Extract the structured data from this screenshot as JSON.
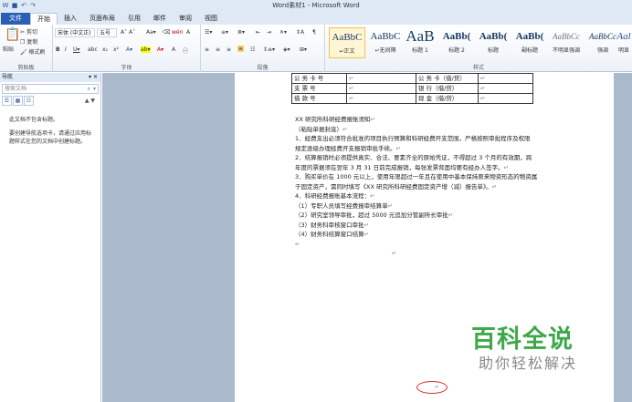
{
  "window": {
    "title": "Word素材1 - Microsoft Word"
  },
  "tabs": [
    "文件",
    "开始",
    "插入",
    "页面布局",
    "引用",
    "邮件",
    "审阅",
    "视图"
  ],
  "ribbon": {
    "clipboard": {
      "label": "剪贴板",
      "paste": "粘贴",
      "cut": "剪切",
      "copy": "复制",
      "format_painter": "格式刷"
    },
    "font": {
      "label": "字体",
      "font_name": "宋体 (中文正)",
      "font_size": "五号"
    },
    "paragraph": {
      "label": "段落"
    },
    "styles": {
      "label": "样式",
      "items": [
        {
          "preview": "AaBbC",
          "name": "↵正文"
        },
        {
          "preview": "AaBbC",
          "name": "↵无间隔"
        },
        {
          "preview": "AaB",
          "name": "标题 1"
        },
        {
          "preview": "AaBb(",
          "name": "标题 2"
        },
        {
          "preview": "AaBb(",
          "name": "标题"
        },
        {
          "preview": "AaBb(",
          "name": "副标题"
        },
        {
          "preview": "AaBbCc",
          "name": "不明显强调"
        },
        {
          "preview": "AaBbCc",
          "name": "强调"
        },
        {
          "preview": "Aal",
          "name": "明显"
        }
      ]
    }
  },
  "nav": {
    "title": "导航",
    "search_placeholder": "搜索文档",
    "message1": "此文档不包含标题。",
    "message2": "要创建导航选项卡，请通过应用标题样式在您的文档中创建标题。"
  },
  "doc": {
    "table": [
      [
        "公 务 卡 号",
        "",
        "公 务 卡（借/贷）",
        ""
      ],
      [
        "支 票 号",
        "",
        "银 行（借/贷）",
        ""
      ],
      [
        "借 款 号",
        "",
        "现 金（借/贷）",
        ""
      ]
    ],
    "lines": [
      "XX 研究所科研经费报账须知",
      "（粘贴单据封底）",
      "1．经费支出必须符合批准的项目执行预算和科研经费开支范围，严格按照审批程序及权限",
      "规定逐级办理经费开支报销审批手续。",
      "2．结算报销时必须提供真实、合法、要素齐全的原始凭证，不得超过 3 个月的有效期，跨",
      "年度的票据须在翌年 3 月 31 日前完成报销，每张发票背面均要有经办人签字。",
      "3．购买单价在 1000 元以上，使用年限超过一年且在使用中基本保持原来物资形态的物资属",
      "于固定资产，需同时填写《XX 研究所科研经费固定资产增（减）报告单》。",
      "4．科研经费报账基本流程：",
      "（1）专职人员填写经费报审结算单",
      "（2）研究室领导审批，超过 5000 元追加分管副所长审批",
      "（3）财务科审核窗口审批",
      "（4）财务科结算窗口结算"
    ]
  },
  "watermark": {
    "title": "百科全说",
    "subtitle": "助你轻松解决"
  }
}
